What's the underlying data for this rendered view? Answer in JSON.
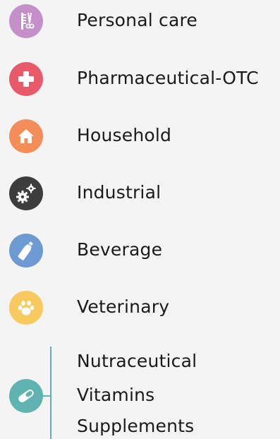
{
  "categories": [
    {
      "label": "Personal care",
      "icon": "comb-scissors-icon",
      "color": "#c58fc9"
    },
    {
      "label": "Pharmaceutical-OTC",
      "icon": "medical-cross-icon",
      "color": "#e8596a"
    },
    {
      "label": "Household",
      "icon": "house-icon",
      "color": "#f48d57"
    },
    {
      "label": "Industrial",
      "icon": "gears-icon",
      "color": "#3d3d3d"
    },
    {
      "label": "Beverage",
      "icon": "bottle-icon",
      "color": "#6d9ad2"
    },
    {
      "label": "Veterinary",
      "icon": "paw-icon",
      "color": "#f7c95e"
    }
  ],
  "group": {
    "icon": "capsule-icon",
    "color": "#5fb3b1",
    "items": [
      "Nutraceutical",
      "Vitamins",
      "Supplements"
    ]
  }
}
